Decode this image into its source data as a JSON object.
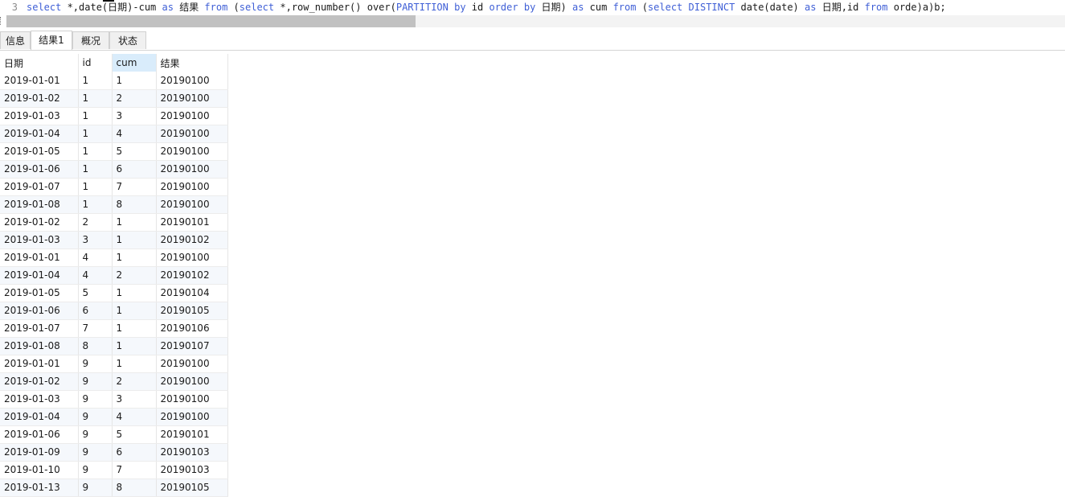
{
  "editor": {
    "line_number": "3",
    "sql_tokens": [
      {
        "t": "select",
        "kw": true
      },
      {
        "t": " *,date(日期)-cum ",
        "kw": false
      },
      {
        "t": "as",
        "kw": true
      },
      {
        "t": " 结果 ",
        "kw": false
      },
      {
        "t": "from",
        "kw": true
      },
      {
        "t": " (",
        "kw": false
      },
      {
        "t": "select",
        "kw": true
      },
      {
        "t": " *,row_number() over(",
        "kw": false
      },
      {
        "t": "PARTITION",
        "kw": true
      },
      {
        "t": " ",
        "kw": false
      },
      {
        "t": "by",
        "kw": true
      },
      {
        "t": " id ",
        "kw": false
      },
      {
        "t": "order",
        "kw": true
      },
      {
        "t": " ",
        "kw": false
      },
      {
        "t": "by",
        "kw": true
      },
      {
        "t": " 日期) ",
        "kw": false
      },
      {
        "t": "as",
        "kw": true
      },
      {
        "t": " cum ",
        "kw": false
      },
      {
        "t": "from",
        "kw": true
      },
      {
        "t": " (",
        "kw": false
      },
      {
        "t": "select",
        "kw": true
      },
      {
        "t": " ",
        "kw": false
      },
      {
        "t": "DISTINCT",
        "kw": true
      },
      {
        "t": " date(date) ",
        "kw": false
      },
      {
        "t": "as",
        "kw": true
      },
      {
        "t": " 日期,id ",
        "kw": false
      },
      {
        "t": "from",
        "kw": true
      },
      {
        "t": " orde)a)b;",
        "kw": false
      }
    ]
  },
  "colors": {
    "keyword": "#3f5fd6",
    "sorted_header": "#d9ecfb",
    "alt_row": "#f5f8fc"
  },
  "tabs": [
    {
      "label": "信息",
      "active": false
    },
    {
      "label": "结果1",
      "active": true
    },
    {
      "label": "概况",
      "active": false
    },
    {
      "label": "状态",
      "active": false
    }
  ],
  "grid": {
    "columns": [
      "日期",
      "id",
      "cum",
      "结果"
    ],
    "sorted_column": "cum",
    "rows": [
      [
        "2019-01-01",
        "1",
        "1",
        "20190100"
      ],
      [
        "2019-01-02",
        "1",
        "2",
        "20190100"
      ],
      [
        "2019-01-03",
        "1",
        "3",
        "20190100"
      ],
      [
        "2019-01-04",
        "1",
        "4",
        "20190100"
      ],
      [
        "2019-01-05",
        "1",
        "5",
        "20190100"
      ],
      [
        "2019-01-06",
        "1",
        "6",
        "20190100"
      ],
      [
        "2019-01-07",
        "1",
        "7",
        "20190100"
      ],
      [
        "2019-01-08",
        "1",
        "8",
        "20190100"
      ],
      [
        "2019-01-02",
        "2",
        "1",
        "20190101"
      ],
      [
        "2019-01-03",
        "3",
        "1",
        "20190102"
      ],
      [
        "2019-01-01",
        "4",
        "1",
        "20190100"
      ],
      [
        "2019-01-04",
        "4",
        "2",
        "20190102"
      ],
      [
        "2019-01-05",
        "5",
        "1",
        "20190104"
      ],
      [
        "2019-01-06",
        "6",
        "1",
        "20190105"
      ],
      [
        "2019-01-07",
        "7",
        "1",
        "20190106"
      ],
      [
        "2019-01-08",
        "8",
        "1",
        "20190107"
      ],
      [
        "2019-01-01",
        "9",
        "1",
        "20190100"
      ],
      [
        "2019-01-02",
        "9",
        "2",
        "20190100"
      ],
      [
        "2019-01-03",
        "9",
        "3",
        "20190100"
      ],
      [
        "2019-01-04",
        "9",
        "4",
        "20190100"
      ],
      [
        "2019-01-06",
        "9",
        "5",
        "20190101"
      ],
      [
        "2019-01-09",
        "9",
        "6",
        "20190103"
      ],
      [
        "2019-01-10",
        "9",
        "7",
        "20190103"
      ],
      [
        "2019-01-13",
        "9",
        "8",
        "20190105"
      ]
    ]
  }
}
